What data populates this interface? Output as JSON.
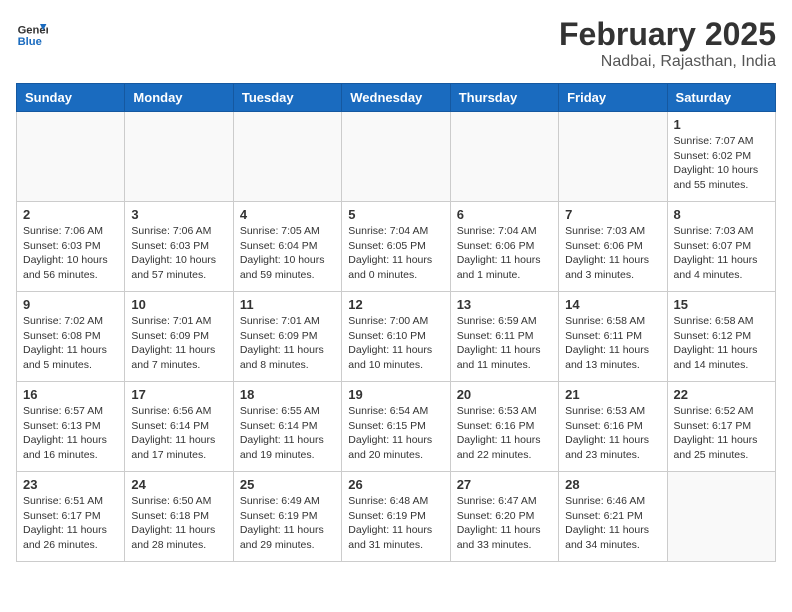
{
  "header": {
    "logo_line1": "General",
    "logo_line2": "Blue",
    "month_year": "February 2025",
    "location": "Nadbai, Rajasthan, India"
  },
  "weekdays": [
    "Sunday",
    "Monday",
    "Tuesday",
    "Wednesday",
    "Thursday",
    "Friday",
    "Saturday"
  ],
  "weeks": [
    [
      {
        "day": "",
        "info": ""
      },
      {
        "day": "",
        "info": ""
      },
      {
        "day": "",
        "info": ""
      },
      {
        "day": "",
        "info": ""
      },
      {
        "day": "",
        "info": ""
      },
      {
        "day": "",
        "info": ""
      },
      {
        "day": "1",
        "info": "Sunrise: 7:07 AM\nSunset: 6:02 PM\nDaylight: 10 hours and 55 minutes."
      }
    ],
    [
      {
        "day": "2",
        "info": "Sunrise: 7:06 AM\nSunset: 6:03 PM\nDaylight: 10 hours and 56 minutes."
      },
      {
        "day": "3",
        "info": "Sunrise: 7:06 AM\nSunset: 6:03 PM\nDaylight: 10 hours and 57 minutes."
      },
      {
        "day": "4",
        "info": "Sunrise: 7:05 AM\nSunset: 6:04 PM\nDaylight: 10 hours and 59 minutes."
      },
      {
        "day": "5",
        "info": "Sunrise: 7:04 AM\nSunset: 6:05 PM\nDaylight: 11 hours and 0 minutes."
      },
      {
        "day": "6",
        "info": "Sunrise: 7:04 AM\nSunset: 6:06 PM\nDaylight: 11 hours and 1 minute."
      },
      {
        "day": "7",
        "info": "Sunrise: 7:03 AM\nSunset: 6:06 PM\nDaylight: 11 hours and 3 minutes."
      },
      {
        "day": "8",
        "info": "Sunrise: 7:03 AM\nSunset: 6:07 PM\nDaylight: 11 hours and 4 minutes."
      }
    ],
    [
      {
        "day": "9",
        "info": "Sunrise: 7:02 AM\nSunset: 6:08 PM\nDaylight: 11 hours and 5 minutes."
      },
      {
        "day": "10",
        "info": "Sunrise: 7:01 AM\nSunset: 6:09 PM\nDaylight: 11 hours and 7 minutes."
      },
      {
        "day": "11",
        "info": "Sunrise: 7:01 AM\nSunset: 6:09 PM\nDaylight: 11 hours and 8 minutes."
      },
      {
        "day": "12",
        "info": "Sunrise: 7:00 AM\nSunset: 6:10 PM\nDaylight: 11 hours and 10 minutes."
      },
      {
        "day": "13",
        "info": "Sunrise: 6:59 AM\nSunset: 6:11 PM\nDaylight: 11 hours and 11 minutes."
      },
      {
        "day": "14",
        "info": "Sunrise: 6:58 AM\nSunset: 6:11 PM\nDaylight: 11 hours and 13 minutes."
      },
      {
        "day": "15",
        "info": "Sunrise: 6:58 AM\nSunset: 6:12 PM\nDaylight: 11 hours and 14 minutes."
      }
    ],
    [
      {
        "day": "16",
        "info": "Sunrise: 6:57 AM\nSunset: 6:13 PM\nDaylight: 11 hours and 16 minutes."
      },
      {
        "day": "17",
        "info": "Sunrise: 6:56 AM\nSunset: 6:14 PM\nDaylight: 11 hours and 17 minutes."
      },
      {
        "day": "18",
        "info": "Sunrise: 6:55 AM\nSunset: 6:14 PM\nDaylight: 11 hours and 19 minutes."
      },
      {
        "day": "19",
        "info": "Sunrise: 6:54 AM\nSunset: 6:15 PM\nDaylight: 11 hours and 20 minutes."
      },
      {
        "day": "20",
        "info": "Sunrise: 6:53 AM\nSunset: 6:16 PM\nDaylight: 11 hours and 22 minutes."
      },
      {
        "day": "21",
        "info": "Sunrise: 6:53 AM\nSunset: 6:16 PM\nDaylight: 11 hours and 23 minutes."
      },
      {
        "day": "22",
        "info": "Sunrise: 6:52 AM\nSunset: 6:17 PM\nDaylight: 11 hours and 25 minutes."
      }
    ],
    [
      {
        "day": "23",
        "info": "Sunrise: 6:51 AM\nSunset: 6:17 PM\nDaylight: 11 hours and 26 minutes."
      },
      {
        "day": "24",
        "info": "Sunrise: 6:50 AM\nSunset: 6:18 PM\nDaylight: 11 hours and 28 minutes."
      },
      {
        "day": "25",
        "info": "Sunrise: 6:49 AM\nSunset: 6:19 PM\nDaylight: 11 hours and 29 minutes."
      },
      {
        "day": "26",
        "info": "Sunrise: 6:48 AM\nSunset: 6:19 PM\nDaylight: 11 hours and 31 minutes."
      },
      {
        "day": "27",
        "info": "Sunrise: 6:47 AM\nSunset: 6:20 PM\nDaylight: 11 hours and 33 minutes."
      },
      {
        "day": "28",
        "info": "Sunrise: 6:46 AM\nSunset: 6:21 PM\nDaylight: 11 hours and 34 minutes."
      },
      {
        "day": "",
        "info": ""
      }
    ]
  ]
}
